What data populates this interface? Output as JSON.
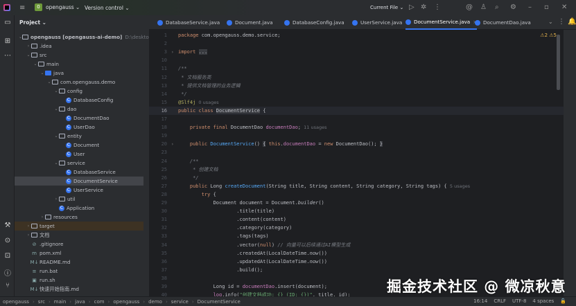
{
  "titlebar": {
    "project_badge": "0",
    "project": "opengauss ⌄",
    "vcs": "Version control ⌄",
    "run_config": "Current File ⌄"
  },
  "project_panel": {
    "title": "Project ⌄",
    "tree": [
      {
        "d": 0,
        "a": "⌄",
        "i": "module",
        "label": "opengauss [opengauss-ai-demo]",
        "extra": "D:\\desktop\\op..."
      },
      {
        "d": 1,
        "a": "›",
        "i": "folder",
        "label": ".idea"
      },
      {
        "d": 1,
        "a": "⌄",
        "i": "folder",
        "label": "src"
      },
      {
        "d": 2,
        "a": "⌄",
        "i": "folder",
        "label": "main"
      },
      {
        "d": 3,
        "a": "⌄",
        "i": "srcfolder",
        "label": "java"
      },
      {
        "d": 4,
        "a": "⌄",
        "i": "package",
        "label": "com.opengauss.demo"
      },
      {
        "d": 5,
        "a": "⌄",
        "i": "package",
        "label": "config"
      },
      {
        "d": 6,
        "a": "",
        "i": "class",
        "label": "DatabaseConfig"
      },
      {
        "d": 5,
        "a": "⌄",
        "i": "package",
        "label": "dao"
      },
      {
        "d": 6,
        "a": "",
        "i": "class",
        "label": "DocumentDao"
      },
      {
        "d": 6,
        "a": "",
        "i": "class",
        "label": "UserDao"
      },
      {
        "d": 5,
        "a": "⌄",
        "i": "package",
        "label": "entity"
      },
      {
        "d": 6,
        "a": "",
        "i": "class",
        "label": "Document"
      },
      {
        "d": 6,
        "a": "",
        "i": "class",
        "label": "User"
      },
      {
        "d": 5,
        "a": "⌄",
        "i": "package",
        "label": "service"
      },
      {
        "d": 6,
        "a": "",
        "i": "class",
        "label": "DatabaseService"
      },
      {
        "d": 6,
        "a": "",
        "i": "class",
        "label": "DocumentService",
        "sel": true
      },
      {
        "d": 6,
        "a": "",
        "i": "class",
        "label": "UserService"
      },
      {
        "d": 5,
        "a": "›",
        "i": "package",
        "label": "util"
      },
      {
        "d": 5,
        "a": "",
        "i": "class",
        "label": "Application"
      },
      {
        "d": 3,
        "a": "›",
        "i": "folder",
        "label": "resources"
      },
      {
        "d": 1,
        "a": "›",
        "i": "folder",
        "label": "target",
        "excl": true
      },
      {
        "d": 1,
        "a": "›",
        "i": "folder",
        "label": "文档"
      },
      {
        "d": 1,
        "a": "",
        "i": "ignore",
        "label": ".gitignore"
      },
      {
        "d": 1,
        "a": "",
        "i": "maven",
        "label": "pom.xml"
      },
      {
        "d": 1,
        "a": "",
        "i": "md",
        "label": "README.md"
      },
      {
        "d": 1,
        "a": "",
        "i": "bat",
        "label": "run.bat"
      },
      {
        "d": 1,
        "a": "",
        "i": "sh",
        "label": "run.sh"
      },
      {
        "d": 1,
        "a": "",
        "i": "md",
        "label": "快速开始指南.md"
      }
    ]
  },
  "tabs": [
    {
      "label": "DatabaseService.java"
    },
    {
      "label": "Document.java"
    },
    {
      "label": "DatabaseConfig.java"
    },
    {
      "label": "UserService.java"
    },
    {
      "label": "DocumentService.java",
      "active": true
    },
    {
      "label": "DocumentDao.java"
    }
  ],
  "inspections": {
    "warnings": "⚠2",
    "weak": "⚠5"
  },
  "code": [
    {
      "n": "1",
      "t": [
        [
          "kw",
          "package "
        ],
        [
          "txt",
          "com.opengauss.demo.service;"
        ]
      ]
    },
    {
      "n": "2",
      "t": []
    },
    {
      "n": "3",
      "f": "›",
      "t": [
        [
          "kw",
          "import "
        ],
        [
          "fold-box",
          "..."
        ]
      ]
    },
    {
      "n": "10",
      "t": []
    },
    {
      "n": "11",
      "t": [
        [
          "cmt",
          "/**"
        ]
      ]
    },
    {
      "n": "12",
      "t": [
        [
          "cmt",
          " * 文档服务类"
        ]
      ]
    },
    {
      "n": "13",
      "t": [
        [
          "cmt",
          " * 提供文档管理的业务逻辑"
        ]
      ]
    },
    {
      "n": "14",
      "t": [
        [
          "cmt",
          " */"
        ]
      ]
    },
    {
      "n": "15",
      "t": [
        [
          "ann",
          "@Slf4j"
        ],
        [
          "hint",
          "  0 usages"
        ]
      ]
    },
    {
      "n": "16",
      "cur": true,
      "t": [
        [
          "kw",
          "public class "
        ],
        [
          "fold-box",
          "DocumentService"
        ],
        [
          "txt",
          " {"
        ]
      ]
    },
    {
      "n": "17",
      "t": []
    },
    {
      "n": "18",
      "t": [
        [
          "kw",
          "    private final "
        ],
        [
          "txt",
          "DocumentDao "
        ],
        [
          "fld",
          "documentDao"
        ],
        [
          "txt",
          ";"
        ],
        [
          "hint",
          "  11 usages"
        ]
      ]
    },
    {
      "n": "19",
      "t": []
    },
    {
      "n": "20",
      "f": "›",
      "t": [
        [
          "kw",
          "    public "
        ],
        [
          "mth",
          "DocumentService"
        ],
        [
          "txt",
          "() "
        ],
        [
          "fold-box",
          "{"
        ],
        [
          "txt",
          " "
        ],
        [
          "kw",
          "this"
        ],
        [
          "txt",
          "."
        ],
        [
          "fld",
          "documentDao"
        ],
        [
          "txt",
          " = "
        ],
        [
          "kw",
          "new "
        ],
        [
          "txt",
          "DocumentDao(); "
        ],
        [
          "fold-box",
          "}"
        ]
      ]
    },
    {
      "n": "23",
      "t": []
    },
    {
      "n": "24",
      "t": [
        [
          "cmt",
          "    /**"
        ]
      ]
    },
    {
      "n": "25",
      "t": [
        [
          "cmt",
          "     * 创建文档"
        ]
      ]
    },
    {
      "n": "26",
      "t": [
        [
          "cmt",
          "     */"
        ]
      ]
    },
    {
      "n": "27",
      "t": [
        [
          "kw",
          "    public "
        ],
        [
          "txt",
          "Long "
        ],
        [
          "mth",
          "createDocument"
        ],
        [
          "txt",
          "(String title, String content, String category, String tags) {"
        ],
        [
          "hint",
          "  5 usages"
        ]
      ]
    },
    {
      "n": "28",
      "t": [
        [
          "kw",
          "        try "
        ],
        [
          "txt",
          "{"
        ]
      ]
    },
    {
      "n": "29",
      "t": [
        [
          "txt",
          "            Document document = Document."
        ],
        [
          "itl",
          "builder"
        ],
        [
          "txt",
          "()"
        ]
      ]
    },
    {
      "n": "30",
      "t": [
        [
          "txt",
          "                    .title(title)"
        ]
      ]
    },
    {
      "n": "31",
      "t": [
        [
          "txt",
          "                    .content(content)"
        ]
      ]
    },
    {
      "n": "32",
      "t": [
        [
          "txt",
          "                    .category(category)"
        ]
      ]
    },
    {
      "n": "33",
      "t": [
        [
          "txt",
          "                    .tags(tags)"
        ]
      ]
    },
    {
      "n": "34",
      "t": [
        [
          "txt",
          "                    .vector("
        ],
        [
          "kw",
          "null"
        ],
        [
          "txt",
          ") "
        ],
        [
          "cmt",
          "// 向量可以后续通过AI模型生成"
        ]
      ]
    },
    {
      "n": "35",
      "t": [
        [
          "txt",
          "                    .createdAt(LocalDateTime."
        ],
        [
          "itl",
          "now"
        ],
        [
          "txt",
          "())"
        ]
      ]
    },
    {
      "n": "36",
      "t": [
        [
          "txt",
          "                    .updatedAt(LocalDateTime."
        ],
        [
          "itl",
          "now"
        ],
        [
          "txt",
          "())"
        ]
      ]
    },
    {
      "n": "37",
      "t": [
        [
          "txt",
          "                    .build();"
        ]
      ]
    },
    {
      "n": "38",
      "t": []
    },
    {
      "n": "39",
      "t": [
        [
          "txt",
          "            Long id = "
        ],
        [
          "fld",
          "documentDao"
        ],
        [
          "txt",
          ".insert(document);"
        ]
      ]
    },
    {
      "n": "40",
      "t": [
        [
          "fld",
          "            log"
        ],
        [
          "txt",
          ".info("
        ],
        [
          "str",
          "\"创建文档成功: {} (ID: {})\""
        ],
        [
          "txt",
          ", title, id);"
        ]
      ]
    }
  ],
  "statusbar": {
    "breadcrumb": [
      "opengauss",
      "src",
      "main",
      "java",
      "com",
      "opengauss",
      "demo",
      "service",
      "DocumentService"
    ],
    "position": "16:14",
    "line_sep": "CRLF",
    "encoding": "UTF-8",
    "indent": "4 spaces"
  },
  "watermark": "掘金技术社区 @ 微凉秋意"
}
